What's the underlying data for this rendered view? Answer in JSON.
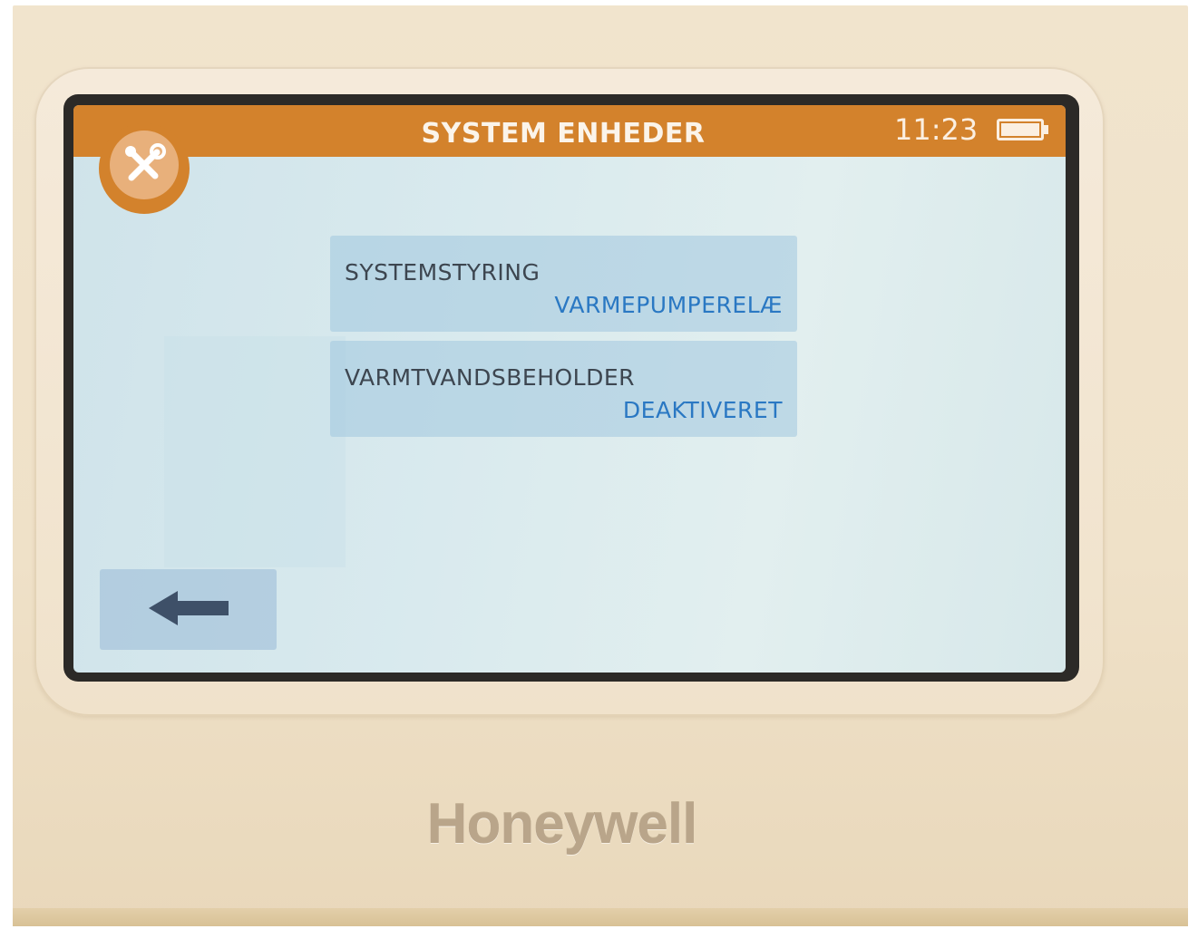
{
  "header": {
    "title": "SYSTEM ENHEDER",
    "time": "11:23",
    "battery_icon": "battery-icon",
    "settings_icon": "tools-icon"
  },
  "menu": {
    "items": [
      {
        "label": "SYSTEMSTYRING",
        "value": "VARMEPUMPERELÆ"
      },
      {
        "label": "VARMTVANDSBEHOLDER",
        "value": "DEAKTIVERET"
      }
    ]
  },
  "navigation": {
    "back_icon": "arrow-left-icon"
  },
  "device": {
    "brand": "Honeywell"
  },
  "colors": {
    "accent": "#d3822c",
    "value_text": "#2a78c3",
    "screen_bg": "#d9eaee"
  }
}
